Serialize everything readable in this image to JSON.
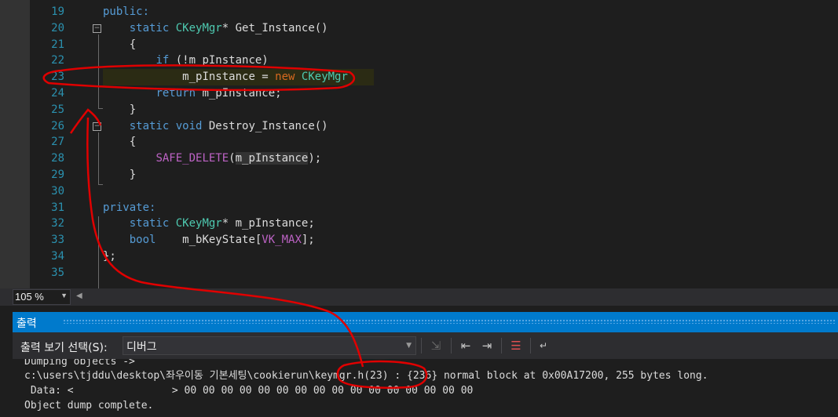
{
  "editor": {
    "line_numbers": [
      "19",
      "20",
      "21",
      "22",
      "23",
      "24",
      "25",
      "26",
      "27",
      "28",
      "29",
      "30",
      "31",
      "32",
      "33",
      "34",
      "35"
    ],
    "code": {
      "l19_kw": "public:",
      "l20_kw": "static",
      "l20_type": "CKeyMgr",
      "l20_rest": "* Get_Instance()",
      "l21": "{",
      "l22_kw": "if",
      "l22_rest": " (!m_pInstance)",
      "l23_a": "m_pInstance = ",
      "l23_kw": "new",
      "l23_type": "CKeyMgr",
      "l24_kw": "return",
      "l24_rest": " m_pInstance;",
      "l25": "}",
      "l26_kw1": "static",
      "l26_kw2": "void",
      "l26_rest": " Destroy_Instance()",
      "l27": "{",
      "l28_macro": "SAFE_DELETE",
      "l28_open": "(",
      "l28_arg": "m_pInstance",
      "l28_close": ");",
      "l29": "}",
      "l31_kw": "private:",
      "l32_kw": "static",
      "l32_type": "CKeyMgr",
      "l32_rest": "* m_pInstance;",
      "l33_kw": "bool",
      "l33_mid": "    m_bKeyState[",
      "l33_enum": "VK_MAX",
      "l33_end": "];",
      "l34": "};"
    }
  },
  "zoom": {
    "value": "105 %"
  },
  "output": {
    "title": "출력",
    "source_label": "출력 보기 선택(S):",
    "source_value": "디버그",
    "lines": [
      "Dumping objects ->",
      "c:\\users\\tjddu\\desktop\\좌우이동 기본세팅\\cookierun\\keymgr.h(23) : {236} normal block at 0x00A17200, 255 bytes long.",
      " Data: <                > 00 00 00 00 00 00 00 00 00 00 00 00 00 00 00 00",
      "Object dump complete."
    ]
  },
  "icons": {
    "fold": "fold-minus-icon",
    "zoom_dropdown": "chevron-down-icon",
    "find_message": "find-message-icon",
    "prev_message": "go-to-previous-message-icon",
    "next_message": "go-to-next-message-icon",
    "clear_all": "clear-all-icon",
    "word_wrap": "word-wrap-icon"
  },
  "colors": {
    "keyword": "#569cd6",
    "type": "#4ec9b0",
    "macro": "#bd63c5",
    "line_number": "#2b91af",
    "output_title": "#007acc",
    "annotation": "#e00000"
  }
}
